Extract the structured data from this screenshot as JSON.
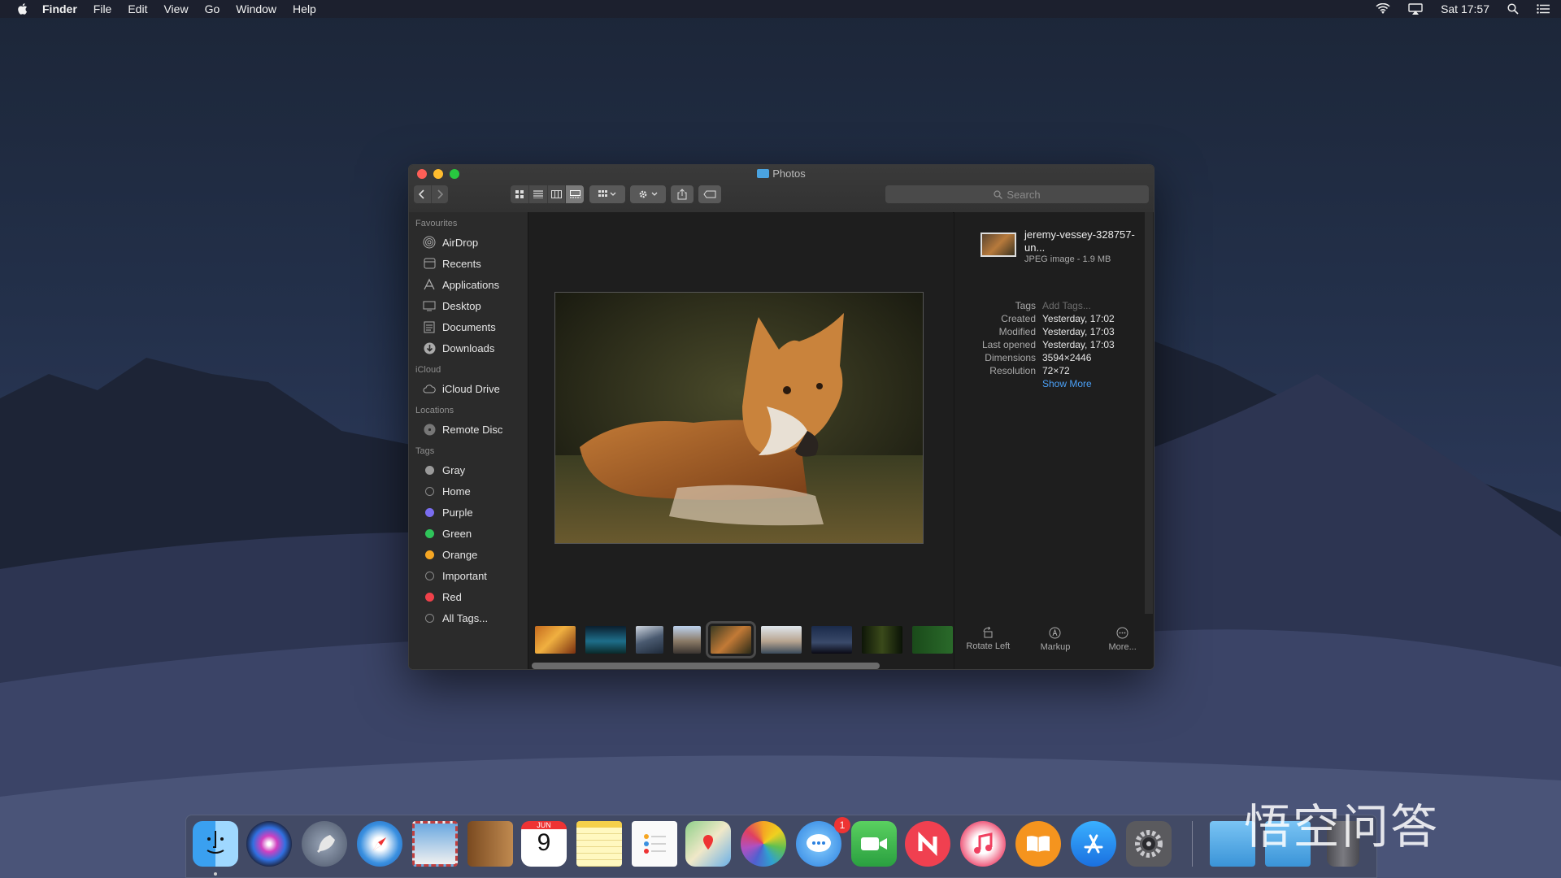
{
  "menubar": {
    "app": "Finder",
    "items": [
      "File",
      "Edit",
      "View",
      "Go",
      "Window",
      "Help"
    ],
    "clock": "Sat 17:57"
  },
  "window": {
    "title": "Photos",
    "search_placeholder": "Search"
  },
  "sidebar": {
    "sections": [
      {
        "title": "Favourites",
        "items": [
          {
            "label": "AirDrop",
            "icon": "airdrop-icon"
          },
          {
            "label": "Recents",
            "icon": "recents-icon"
          },
          {
            "label": "Applications",
            "icon": "applications-icon"
          },
          {
            "label": "Desktop",
            "icon": "desktop-icon"
          },
          {
            "label": "Documents",
            "icon": "documents-icon"
          },
          {
            "label": "Downloads",
            "icon": "downloads-icon"
          }
        ]
      },
      {
        "title": "iCloud",
        "items": [
          {
            "label": "iCloud Drive",
            "icon": "cloud-icon"
          }
        ]
      },
      {
        "title": "Locations",
        "items": [
          {
            "label": "Remote Disc",
            "icon": "disc-icon"
          }
        ]
      },
      {
        "title": "Tags",
        "items": [
          {
            "label": "Gray",
            "color": "#9a9a9a"
          },
          {
            "label": "Home",
            "color": ""
          },
          {
            "label": "Purple",
            "color": "#7a6df0"
          },
          {
            "label": "Green",
            "color": "#2fc45a"
          },
          {
            "label": "Orange",
            "color": "#f5a623"
          },
          {
            "label": "Important",
            "color": ""
          },
          {
            "label": "Red",
            "color": "#f0414a"
          },
          {
            "label": "All Tags...",
            "color": ""
          }
        ]
      }
    ]
  },
  "preview": {
    "file_name": "jeremy-vessey-328757-un...",
    "file_kind": "JPEG image - 1.9 MB",
    "meta": [
      {
        "key": "Tags",
        "value": "Add Tags..."
      },
      {
        "key": "Created",
        "value": "Yesterday, 17:02"
      },
      {
        "key": "Modified",
        "value": "Yesterday, 17:03"
      },
      {
        "key": "Last opened",
        "value": "Yesterday, 17:03"
      },
      {
        "key": "Dimensions",
        "value": "3594×2446"
      },
      {
        "key": "Resolution",
        "value": "72×72"
      }
    ],
    "show_more": "Show More",
    "actions": [
      "Rotate Left",
      "Markup",
      "More..."
    ]
  },
  "dock": {
    "calendar_month": "JUN",
    "calendar_day": "9",
    "messages_badge": "1",
    "apps": [
      "finder",
      "siri",
      "launchpad",
      "safari",
      "mail",
      "contacts",
      "calendar",
      "notes",
      "reminders",
      "maps",
      "photos",
      "messages",
      "facetime",
      "news",
      "music",
      "books",
      "app-store",
      "system-preferences"
    ]
  },
  "watermark": "悟空问答",
  "colors": {
    "accent": "#4a9ff5",
    "close": "#fe5f57",
    "minimize": "#febc2e",
    "zoom": "#28c840"
  }
}
